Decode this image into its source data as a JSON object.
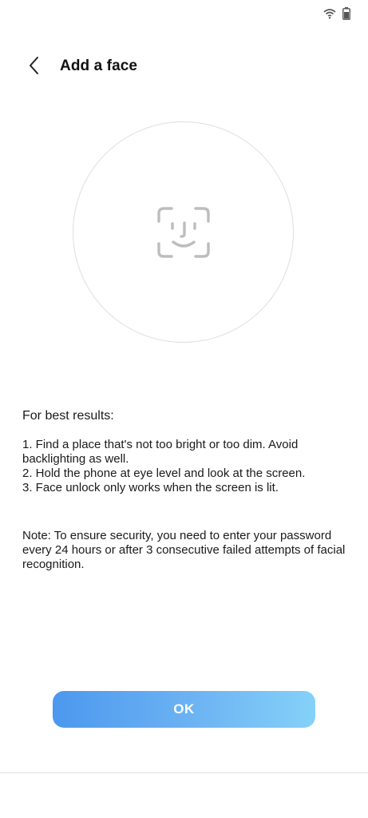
{
  "status_bar": {
    "icons": [
      "wifi-icon",
      "battery-icon"
    ]
  },
  "header": {
    "back_icon": "chevron-left-icon",
    "title": "Add a face"
  },
  "face_illustration": {
    "icon": "face-scan-icon"
  },
  "instructions": {
    "title": "For best results:",
    "steps": [
      "1. Find a place that's not too bright or too dim. Avoid backlighting as well.",
      "2. Hold the phone at eye level and look at the screen.",
      "3. Face unlock only works when the screen is lit."
    ],
    "note": "Note: To ensure security, you need to enter your password every 24 hours or after 3 consecutive failed attempts of facial recognition."
  },
  "actions": {
    "ok_label": "OK"
  },
  "colors": {
    "button_gradient_start": "#4c98ee",
    "button_gradient_end": "#84d1f8",
    "face_icon": "#bdbdbd",
    "circle_border": "#dedede"
  }
}
